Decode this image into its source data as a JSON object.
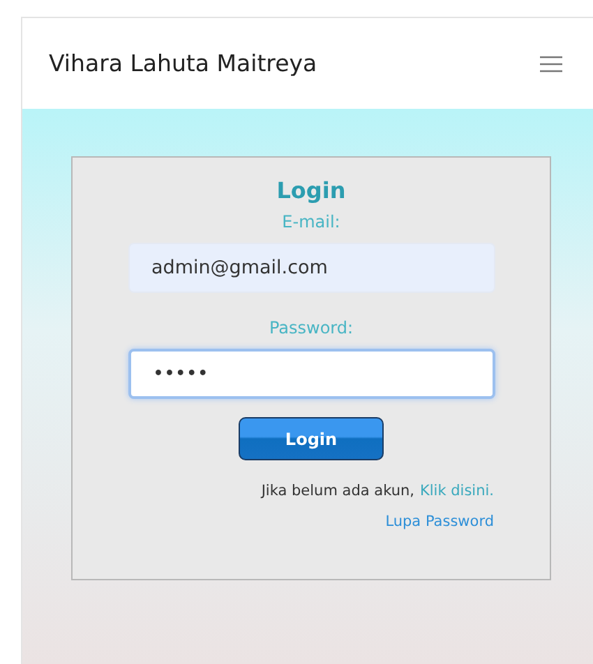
{
  "navbar": {
    "brand": "Vihara Lahuta Maitreya"
  },
  "login": {
    "title": "Login",
    "fields": [
      {
        "label": "E-mail:",
        "value": "admin@gmail.com",
        "focused": false
      },
      {
        "label": "Password:",
        "value": "•••••",
        "focused": true
      }
    ],
    "button": "Login",
    "register": {
      "text": "Jika belum ada akun,",
      "link": "Klik disini."
    },
    "forgot": "Lupa Password"
  }
}
